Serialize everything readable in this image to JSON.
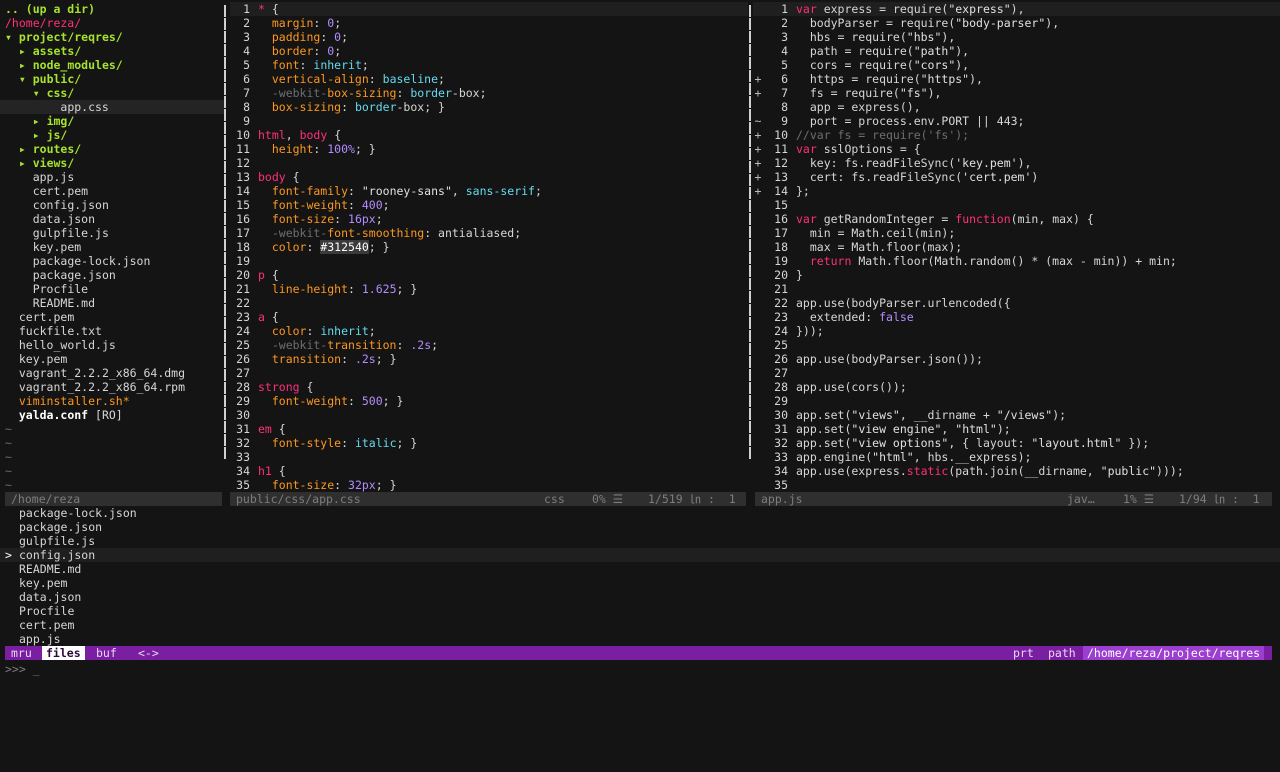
{
  "tree": [
    {
      "text": ".. (up a dir)",
      "type": "up"
    },
    {
      "text": "/home/reza/",
      "type": "root"
    },
    {
      "text": "project/reqres/",
      "type": "dir",
      "indent": 0,
      "arrow": "▾"
    },
    {
      "text": "assets/",
      "type": "dir",
      "indent": 1,
      "arrow": "▸"
    },
    {
      "text": "node_modules/",
      "type": "dir",
      "indent": 1,
      "arrow": "▸"
    },
    {
      "text": "public/",
      "type": "dir",
      "indent": 1,
      "arrow": "▾"
    },
    {
      "text": "css/",
      "type": "dir",
      "indent": 2,
      "arrow": "▾"
    },
    {
      "text": "app.css",
      "type": "file",
      "indent": 4,
      "selected": true
    },
    {
      "text": "img/",
      "type": "dir",
      "indent": 2,
      "arrow": "▸"
    },
    {
      "text": "js/",
      "type": "dir",
      "indent": 2,
      "arrow": "▸"
    },
    {
      "text": "routes/",
      "type": "dir",
      "indent": 1,
      "arrow": "▸"
    },
    {
      "text": "views/",
      "type": "dir",
      "indent": 1,
      "arrow": "▸"
    },
    {
      "text": "app.js",
      "type": "file",
      "indent": 2
    },
    {
      "text": "cert.pem",
      "type": "file",
      "indent": 2
    },
    {
      "text": "config.json",
      "type": "file",
      "indent": 2
    },
    {
      "text": "data.json",
      "type": "file",
      "indent": 2
    },
    {
      "text": "gulpfile.js",
      "type": "file",
      "indent": 2
    },
    {
      "text": "key.pem",
      "type": "file",
      "indent": 2
    },
    {
      "text": "package-lock.json",
      "type": "file",
      "indent": 2
    },
    {
      "text": "package.json",
      "type": "file",
      "indent": 2
    },
    {
      "text": "Procfile",
      "type": "file",
      "indent": 2
    },
    {
      "text": "README.md",
      "type": "file",
      "indent": 2
    },
    {
      "text": "cert.pem",
      "type": "file",
      "indent": 1
    },
    {
      "text": "fuckfile.txt",
      "type": "file",
      "indent": 1
    },
    {
      "text": "hello_world.js",
      "type": "file",
      "indent": 1
    },
    {
      "text": "key.pem",
      "type": "file",
      "indent": 1
    },
    {
      "text": "vagrant_2.2.2_x86_64.dmg",
      "type": "file",
      "indent": 1
    },
    {
      "text": "vagrant_2.2.2_x86_64.rpm",
      "type": "file",
      "indent": 1
    },
    {
      "text": "viminstaller.sh*",
      "type": "exe",
      "indent": 1
    },
    {
      "text": "yalda.conf",
      "type": "boldfile",
      "indent": 1,
      "suffix": " [RO]"
    },
    {
      "text": "~",
      "type": "tilde"
    },
    {
      "text": "~",
      "type": "tilde"
    },
    {
      "text": "~",
      "type": "tilde"
    },
    {
      "text": "~",
      "type": "tilde"
    },
    {
      "text": "~",
      "type": "tilde"
    },
    {
      "text": "~",
      "type": "tilde"
    }
  ],
  "css_lines": [
    [
      [
        "* ",
        "sel-c"
      ],
      [
        "{",
        "pl"
      ]
    ],
    [
      [
        "  margin",
        "prop"
      ],
      [
        ": ",
        "pl"
      ],
      [
        "0",
        "num"
      ],
      [
        ";",
        "pl"
      ]
    ],
    [
      [
        "  padding",
        "prop"
      ],
      [
        ": ",
        "pl"
      ],
      [
        "0",
        "num"
      ],
      [
        ";",
        "pl"
      ]
    ],
    [
      [
        "  border",
        "prop"
      ],
      [
        ": ",
        "pl"
      ],
      [
        "0",
        "num"
      ],
      [
        ";",
        "pl"
      ]
    ],
    [
      [
        "  font",
        "prop"
      ],
      [
        ": ",
        "pl"
      ],
      [
        "inherit",
        "ident"
      ],
      [
        ";",
        "pl"
      ]
    ],
    [
      [
        "  vertical-align",
        "prop"
      ],
      [
        ": ",
        "pl"
      ],
      [
        "baseline",
        "ident"
      ],
      [
        ";",
        "pl"
      ]
    ],
    [
      [
        "  -webkit-",
        "cmt"
      ],
      [
        "box-sizing",
        "prop"
      ],
      [
        ": ",
        "pl"
      ],
      [
        "border",
        "ident"
      ],
      [
        "-box;",
        "pl"
      ]
    ],
    [
      [
        "  box-sizing",
        "prop"
      ],
      [
        ": ",
        "pl"
      ],
      [
        "border",
        "ident"
      ],
      [
        "-box; }",
        "pl"
      ]
    ],
    [],
    [
      [
        "html",
        "sel-c"
      ],
      [
        ", ",
        "pl"
      ],
      [
        "body",
        "sel-c"
      ],
      [
        " {",
        "pl"
      ]
    ],
    [
      [
        "  height",
        "prop"
      ],
      [
        ": ",
        "pl"
      ],
      [
        "100%",
        "num"
      ],
      [
        "; }",
        "pl"
      ]
    ],
    [],
    [
      [
        "body",
        "sel-c"
      ],
      [
        " {",
        "pl"
      ]
    ],
    [
      [
        "  font-family",
        "prop"
      ],
      [
        ": ",
        "pl"
      ],
      [
        "\"rooney-sans\"",
        "str"
      ],
      [
        ", ",
        "pl"
      ],
      [
        "sans-serif",
        "ident"
      ],
      [
        ";",
        "pl"
      ]
    ],
    [
      [
        "  font-weight",
        "prop"
      ],
      [
        ": ",
        "pl"
      ],
      [
        "400",
        "num"
      ],
      [
        ";",
        "pl"
      ]
    ],
    [
      [
        "  font-size",
        "prop"
      ],
      [
        ": ",
        "pl"
      ],
      [
        "16px",
        "num"
      ],
      [
        ";",
        "pl"
      ]
    ],
    [
      [
        "  -webkit-",
        "cmt"
      ],
      [
        "font-smoothing",
        "prop"
      ],
      [
        ": antialiased;",
        "pl"
      ]
    ],
    [
      [
        "  color",
        "prop"
      ],
      [
        ": ",
        "pl"
      ],
      [
        "#312540",
        "hex"
      ],
      [
        "; }",
        "pl"
      ]
    ],
    [],
    [
      [
        "p",
        "sel-c"
      ],
      [
        " {",
        "pl"
      ]
    ],
    [
      [
        "  line-height",
        "prop"
      ],
      [
        ": ",
        "pl"
      ],
      [
        "1.625",
        "num"
      ],
      [
        "; }",
        "pl"
      ]
    ],
    [],
    [
      [
        "a",
        "sel-c"
      ],
      [
        " {",
        "pl"
      ]
    ],
    [
      [
        "  color",
        "prop"
      ],
      [
        ": ",
        "pl"
      ],
      [
        "inherit",
        "ident"
      ],
      [
        ";",
        "pl"
      ]
    ],
    [
      [
        "  -webkit-",
        "cmt"
      ],
      [
        "transition",
        "prop"
      ],
      [
        ": ",
        "pl"
      ],
      [
        ".2s",
        "num"
      ],
      [
        ";",
        "pl"
      ]
    ],
    [
      [
        "  transition",
        "prop"
      ],
      [
        ": ",
        "pl"
      ],
      [
        ".2s",
        "num"
      ],
      [
        "; }",
        "pl"
      ]
    ],
    [],
    [
      [
        "strong",
        "sel-c"
      ],
      [
        " {",
        "pl"
      ]
    ],
    [
      [
        "  font-weight",
        "prop"
      ],
      [
        ": ",
        "pl"
      ],
      [
        "500",
        "num"
      ],
      [
        "; }",
        "pl"
      ]
    ],
    [],
    [
      [
        "em",
        "sel-c"
      ],
      [
        " {",
        "pl"
      ]
    ],
    [
      [
        "  font-style",
        "prop"
      ],
      [
        ": ",
        "pl"
      ],
      [
        "italic",
        "ident"
      ],
      [
        "; }",
        "pl"
      ]
    ],
    [],
    [
      [
        "h1",
        "sel-c"
      ],
      [
        " {",
        "pl"
      ]
    ],
    [
      [
        "  font-size",
        "prop"
      ],
      [
        ": ",
        "pl"
      ],
      [
        "32px",
        "num"
      ],
      [
        "; }",
        "pl"
      ]
    ]
  ],
  "js_lines": [
    {
      "g": "",
      "c": [
        [
          "var ",
          "kw"
        ],
        [
          "express = require(",
          "pl"
        ],
        [
          "\"express\"",
          "str"
        ],
        [
          "),",
          "pl"
        ]
      ]
    },
    {
      "g": "",
      "c": [
        [
          "  bodyParser = require(",
          "pl"
        ],
        [
          "\"body-parser\"",
          "str"
        ],
        [
          "),",
          "pl"
        ]
      ]
    },
    {
      "g": "",
      "c": [
        [
          "  hbs = require(",
          "pl"
        ],
        [
          "\"hbs\"",
          "str"
        ],
        [
          "),",
          "pl"
        ]
      ]
    },
    {
      "g": "",
      "c": [
        [
          "  path = require(",
          "pl"
        ],
        [
          "\"path\"",
          "str"
        ],
        [
          "),",
          "pl"
        ]
      ]
    },
    {
      "g": "",
      "c": [
        [
          "  cors = require(",
          "pl"
        ],
        [
          "\"cors\"",
          "str"
        ],
        [
          "),",
          "pl"
        ]
      ]
    },
    {
      "g": "+",
      "c": [
        [
          "  https = require(",
          "pl"
        ],
        [
          "\"https\"",
          "str"
        ],
        [
          "),",
          "pl"
        ]
      ]
    },
    {
      "g": "+",
      "c": [
        [
          "  fs = require(",
          "pl"
        ],
        [
          "\"fs\"",
          "str"
        ],
        [
          "),",
          "pl"
        ]
      ]
    },
    {
      "g": "",
      "c": [
        [
          "  app = express(),",
          "pl"
        ]
      ]
    },
    {
      "g": "~",
      "c": [
        [
          "  port = process.env.PORT || 443;",
          "pl"
        ]
      ]
    },
    {
      "g": "+",
      "c": [
        [
          "//var fs = require('fs');",
          "cmt"
        ]
      ]
    },
    {
      "g": "+",
      "c": [
        [
          "var ",
          "kw"
        ],
        [
          "sslOptions = {",
          "pl"
        ]
      ]
    },
    {
      "g": "+",
      "c": [
        [
          "  key: fs.readFileSync(",
          "pl"
        ],
        [
          "'key.pem'",
          "str"
        ],
        [
          "),",
          "pl"
        ]
      ]
    },
    {
      "g": "+",
      "c": [
        [
          "  cert: fs.readFileSync(",
          "pl"
        ],
        [
          "'cert.pem'",
          "str"
        ],
        [
          ")",
          "pl"
        ]
      ]
    },
    {
      "g": "+",
      "c": [
        [
          "};",
          "pl"
        ]
      ]
    },
    {
      "g": "",
      "c": []
    },
    {
      "g": "",
      "c": [
        [
          "var ",
          "kw"
        ],
        [
          "getRandomInteger = ",
          "pl"
        ],
        [
          "function",
          "kw"
        ],
        [
          "(min, max) {",
          "pl"
        ]
      ]
    },
    {
      "g": "",
      "c": [
        [
          "  min = Math.ceil(min);",
          "pl"
        ]
      ]
    },
    {
      "g": "",
      "c": [
        [
          "  max = Math.floor(max);",
          "pl"
        ]
      ]
    },
    {
      "g": "",
      "c": [
        [
          "  return ",
          "kw"
        ],
        [
          "Math.floor(Math.random() * (max - min)) + min;",
          "pl"
        ]
      ]
    },
    {
      "g": "",
      "c": [
        [
          "}",
          "pl"
        ]
      ]
    },
    {
      "g": "",
      "c": []
    },
    {
      "g": "",
      "c": [
        [
          "app.use(bodyParser.urlencoded({",
          "pl"
        ]
      ]
    },
    {
      "g": "",
      "c": [
        [
          "  extended: ",
          "pl"
        ],
        [
          "false",
          "num"
        ]
      ]
    },
    {
      "g": "",
      "c": [
        [
          "}));",
          "pl"
        ]
      ]
    },
    {
      "g": "",
      "c": []
    },
    {
      "g": "",
      "c": [
        [
          "app.use(bodyParser.json());",
          "pl"
        ]
      ]
    },
    {
      "g": "",
      "c": []
    },
    {
      "g": "",
      "c": [
        [
          "app.use(cors());",
          "pl"
        ]
      ]
    },
    {
      "g": "",
      "c": []
    },
    {
      "g": "",
      "c": [
        [
          "app.set(",
          "pl"
        ],
        [
          "\"views\"",
          "str"
        ],
        [
          ", __dirname + ",
          "pl"
        ],
        [
          "\"/views\"",
          "str"
        ],
        [
          ");",
          "pl"
        ]
      ]
    },
    {
      "g": "",
      "c": [
        [
          "app.set(",
          "pl"
        ],
        [
          "\"view engine\"",
          "str"
        ],
        [
          ", ",
          "pl"
        ],
        [
          "\"html\"",
          "str"
        ],
        [
          ");",
          "pl"
        ]
      ]
    },
    {
      "g": "",
      "c": [
        [
          "app.set(",
          "pl"
        ],
        [
          "\"view options\"",
          "str"
        ],
        [
          ", { layout: ",
          "pl"
        ],
        [
          "\"layout.html\"",
          "str"
        ],
        [
          " });",
          "pl"
        ]
      ]
    },
    {
      "g": "",
      "c": [
        [
          "app.engine(",
          "pl"
        ],
        [
          "\"html\"",
          "str"
        ],
        [
          ", hbs.__express);",
          "pl"
        ]
      ]
    },
    {
      "g": "",
      "c": [
        [
          "app.use(express.",
          "pl"
        ],
        [
          "static",
          "kw"
        ],
        [
          "(path.join(__dirname, ",
          "pl"
        ],
        [
          "\"public\"",
          "str"
        ],
        [
          ")));",
          "pl"
        ]
      ]
    },
    {
      "g": "",
      "c": []
    }
  ],
  "status": {
    "tree_path": "/home/reza",
    "css_file": "public/css/app.css",
    "css_ft": "css",
    "css_pct": "0% ☰",
    "css_pos": "1/519 ㏑ :  1",
    "js_file": "app.js",
    "js_ft": "jav…",
    "js_pct": "1% ☰",
    "js_pos": "1/94 ㏑ :  1"
  },
  "mru": {
    "items": [
      "package-lock.json",
      "package.json",
      "gulpfile.js",
      "config.json",
      "README.md",
      "key.pem",
      "data.json",
      "Procfile",
      "cert.pem",
      "app.js"
    ],
    "selected": 3,
    "pointer": ">"
  },
  "ctrlp": {
    "mode_mru": "mru",
    "mode_files": "files",
    "mode_buf": "buf",
    "nav": "<->",
    "prt": "prt",
    "path_label": "path",
    "cwd": "/home/reza/project/reqres"
  },
  "prompt": ">>> _"
}
